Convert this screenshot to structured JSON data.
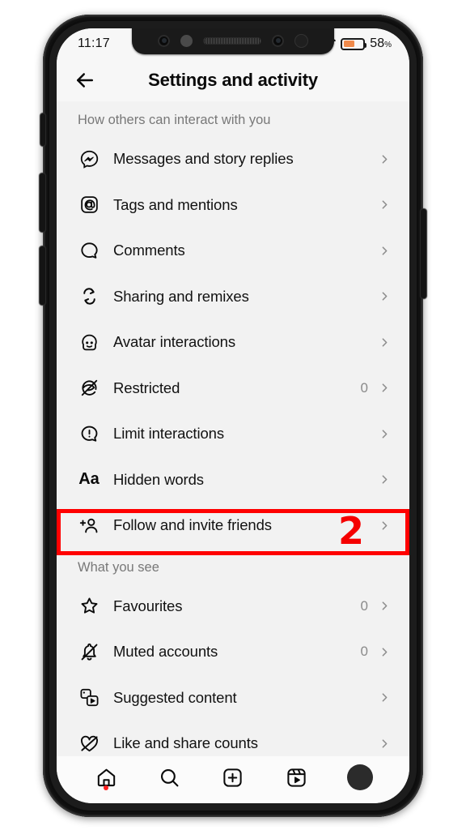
{
  "status_bar": {
    "time": "11:17",
    "wifi_icon": "wifi-icon",
    "battery_icon": "battery-icon",
    "battery_percent": "58",
    "percent_symbol": "%",
    "battery_fill_color": "#f08a4b"
  },
  "header": {
    "back_icon": "back-arrow-icon",
    "title": "Settings and activity"
  },
  "sections": [
    {
      "title": "How others can interact with you",
      "items": [
        {
          "icon": "messenger-icon",
          "label": "Messages and story replies",
          "value": ""
        },
        {
          "icon": "at-mention-icon",
          "label": "Tags and mentions",
          "value": ""
        },
        {
          "icon": "comment-icon",
          "label": "Comments",
          "value": ""
        },
        {
          "icon": "remix-icon",
          "label": "Sharing and remixes",
          "value": ""
        },
        {
          "icon": "avatar-face-icon",
          "label": "Avatar interactions",
          "value": ""
        },
        {
          "icon": "restricted-icon",
          "label": "Restricted",
          "value": "0"
        },
        {
          "icon": "limit-icon",
          "label": "Limit interactions",
          "value": ""
        },
        {
          "icon": "text-aa-icon",
          "label": "Hidden words",
          "value": ""
        },
        {
          "icon": "add-person-icon",
          "label": "Follow and invite friends",
          "value": ""
        }
      ]
    },
    {
      "title": "What you see",
      "items": [
        {
          "icon": "star-icon",
          "label": "Favourites",
          "value": "0"
        },
        {
          "icon": "muted-bell-icon",
          "label": "Muted accounts",
          "value": "0"
        },
        {
          "icon": "suggested-media-icon",
          "label": "Suggested content",
          "value": ""
        },
        {
          "icon": "hidden-heart-icon",
          "label": "Like and share counts",
          "value": ""
        }
      ]
    }
  ],
  "annotation": {
    "step_number": "2",
    "highlight_color": "#ff0000",
    "highlighted_item": "Follow and invite friends"
  },
  "bottom_nav": {
    "items": [
      {
        "icon": "home-icon",
        "badge": true
      },
      {
        "icon": "search-icon",
        "badge": false
      },
      {
        "icon": "add-post-icon",
        "badge": false
      },
      {
        "icon": "reels-icon",
        "badge": false
      },
      {
        "icon": "profile-avatar-icon",
        "badge": false
      }
    ]
  }
}
